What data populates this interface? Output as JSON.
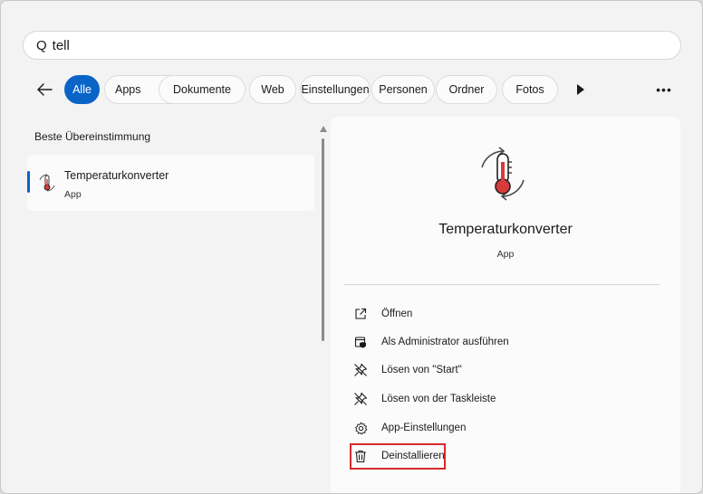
{
  "search": {
    "prefix": "Q",
    "value": "tell"
  },
  "filters": [
    "Alle",
    "Apps",
    "Dokumente",
    "Web",
    "Einstellungen",
    "Personen",
    "Ordner",
    "Fotos"
  ],
  "more_label": "•••",
  "results": {
    "section_title": "Beste Übereinstimmung",
    "items": [
      {
        "name": "Temperaturkonverter",
        "type": "App"
      }
    ]
  },
  "detail": {
    "name": "Temperaturkonverter",
    "type": "App",
    "actions": [
      {
        "label": "Öffnen",
        "icon": "open-external-icon"
      },
      {
        "label": "Als Administrator ausführen",
        "icon": "shield-admin-icon"
      },
      {
        "label": "Lösen von \"Start\"",
        "icon": "unpin-icon"
      },
      {
        "label": "Lösen von der Taskleiste",
        "icon": "unpin-icon"
      },
      {
        "label": "App-Einstellungen",
        "icon": "gear-icon"
      },
      {
        "label": "Deinstallieren",
        "icon": "trash-icon"
      }
    ]
  },
  "colors": {
    "accent": "#0a64c8",
    "highlight": "#d42a2a",
    "thermo_red": "#d93a3a"
  }
}
